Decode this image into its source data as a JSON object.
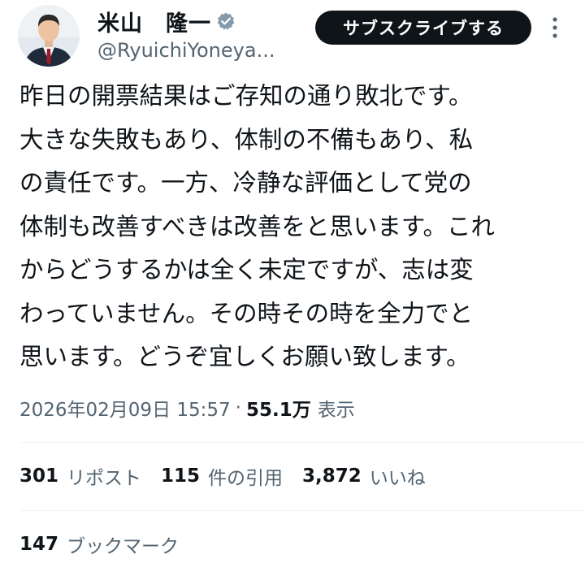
{
  "author": {
    "display_name": "米山　隆一",
    "handle": "@RyuichiYoneya...",
    "verified": true
  },
  "subscribe_button_label": "サブスクライブする",
  "tweet": {
    "lines": [
      "昨日の開票結果はご存知の通り敗北です。",
      "大きな失敗もあり、体制の不備もあり、私",
      "の責任です。一方、冷静な評価として党の",
      "体制も改善すべきは改善をと思います。これ",
      "からどうするかは全く未定ですが、志は変",
      "わっていません。その時その時を全力でと",
      "思います。どうぞ宜しくお願い致します。"
    ]
  },
  "meta": {
    "datetime": "2026年02月09日 15:57",
    "separator": "·",
    "views_count": "55.1万",
    "views_label": "表示"
  },
  "stats": {
    "reposts": {
      "count": "301",
      "label": "リポスト"
    },
    "quotes": {
      "count": "115",
      "label": "件の引用"
    },
    "likes": {
      "count": "3,872",
      "label": "いいね"
    }
  },
  "bookmarks": {
    "count": "147",
    "label": "ブックマーク"
  },
  "colors": {
    "text_primary": "#0f1419",
    "text_secondary": "#536471",
    "button_bg": "#0f1419",
    "verified": "#829aab",
    "divider": "#eff3f4"
  },
  "icons": {
    "verified": "verified-badge-icon",
    "more": "more-vertical-icon"
  }
}
